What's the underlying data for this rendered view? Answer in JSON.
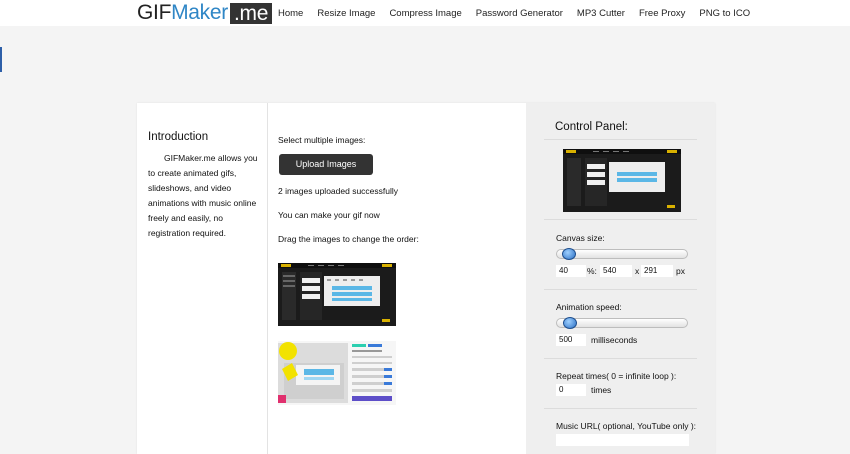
{
  "header": {
    "logo": {
      "gif": "GIF",
      "maker": "Maker",
      "me": ".me"
    },
    "nav": [
      "Home",
      "Resize Image",
      "Compress Image",
      "Password Generator",
      "MP3 Cutter",
      "Free Proxy",
      "PNG to ICO"
    ]
  },
  "intro": {
    "title": "Introduction",
    "body": "GIFMaker.me allows you to create animated gifs, slideshows, and video animations with music online freely and easily, no registration required."
  },
  "main": {
    "select_text": "Select multiple images:",
    "upload_label": "Upload Images",
    "status": "2 images uploaded successfully",
    "ready": "You can make your gif now",
    "drag_hint": "Drag the images to change the order:"
  },
  "control_panel": {
    "title": "Control Panel:",
    "canvas": {
      "label": "Canvas size:",
      "percent": "40",
      "percent_sep": "%:",
      "width": "540",
      "x": "x",
      "height": "291",
      "unit": "px",
      "slider_fraction": 0.04
    },
    "speed": {
      "label": "Animation speed:",
      "value": "500",
      "unit": "milliseconds",
      "slider_fraction": 0.05
    },
    "repeat": {
      "label": "Repeat times( 0 = infinite loop ):",
      "value": "0",
      "unit": "times"
    },
    "music": {
      "label": "Music URL( optional, YouTube only ):",
      "value": ""
    }
  },
  "colors": {
    "brand_blue": "#2f86c6",
    "dark": "#333333",
    "panel_bg": "#efefef"
  }
}
